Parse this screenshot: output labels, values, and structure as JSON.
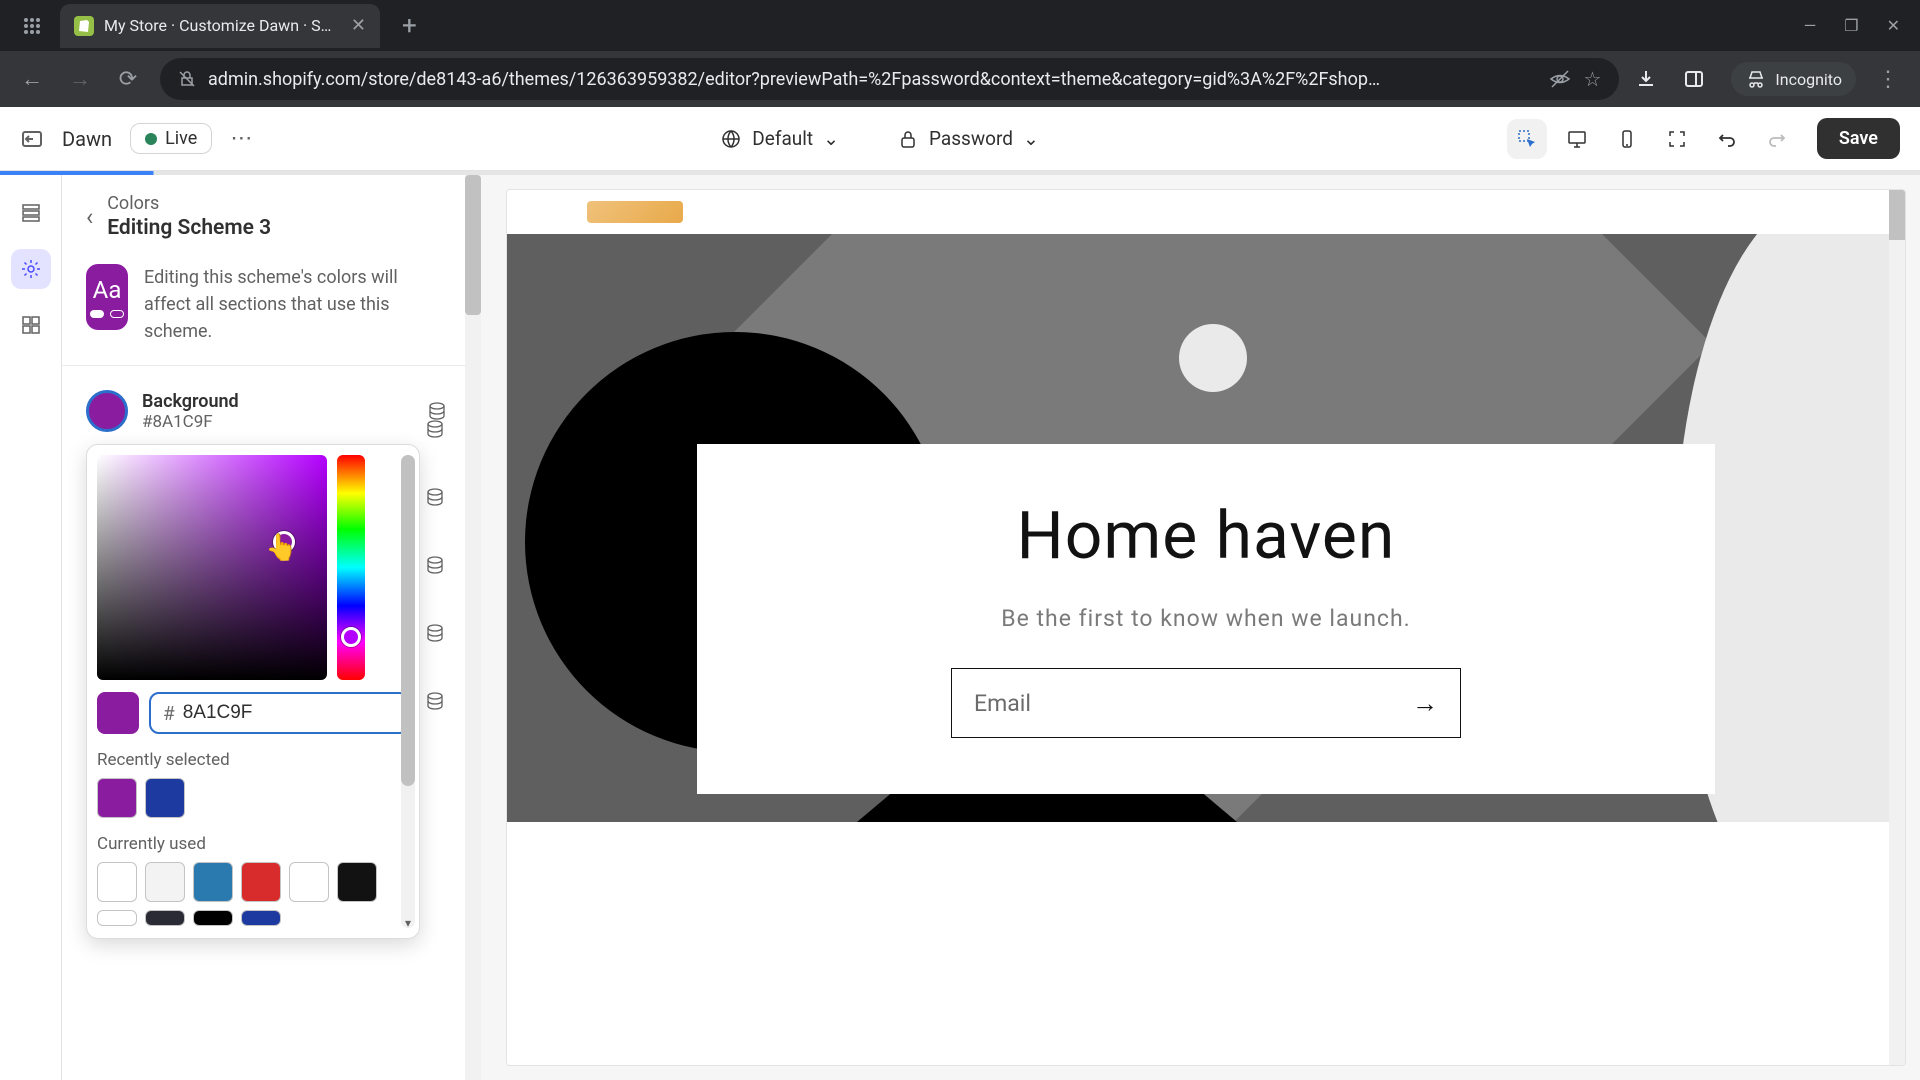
{
  "browser": {
    "tab_title": "My Store · Customize Dawn · S…",
    "url": "admin.shopify.com/store/de8143-a6/themes/126363959382/editor?previewPath=%2Fpassword&context=theme&category=gid%3A%2F%2Fshop…",
    "incognito": "Incognito"
  },
  "topbar": {
    "theme_name": "Dawn",
    "live": "Live",
    "template": "Default",
    "page": "Password",
    "save": "Save"
  },
  "sidebar": {
    "crumb": "Colors",
    "title": "Editing Scheme 3",
    "scheme_badge": "Aa",
    "desc": "Editing this scheme's colors will affect all sections that use this scheme.",
    "bg_label": "Background",
    "bg_hex": "#8A1C9F",
    "hex_value": "8A1C9F",
    "recently": "Recently selected",
    "recent_swatches": [
      "#8a1c9f",
      "#1c3a9f"
    ],
    "currently": "Currently used",
    "current_row1": [
      "#ffffff",
      "#f3f3f3",
      "#2a7ab0",
      "#d82c2c",
      "#ffffff",
      "#121212"
    ],
    "current_row2": [
      "#ffffff",
      "#2b2b36",
      "#000000",
      "#1c3a9f"
    ]
  },
  "preview": {
    "heading": "Home haven",
    "sub": "Be the first to know when we launch.",
    "email_placeholder": "Email"
  }
}
